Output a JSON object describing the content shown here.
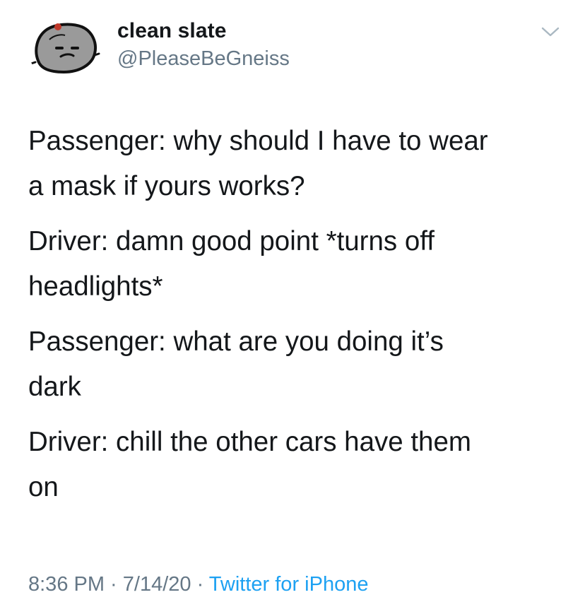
{
  "tweet": {
    "display_name": "clean slate",
    "handle": "@PleaseBeGneiss",
    "avatar_icon": "rock-character-avatar",
    "menu_icon": "chevron-down-icon",
    "lines": [
      "Passenger: why should I have to wear\na mask if yours works?",
      "Driver: damn good point *turns off\nheadlights*",
      "Passenger: what are you doing it’s\ndark",
      "Driver: chill the other cars have them\non"
    ],
    "time": "8:36 PM",
    "separator": " · ",
    "date": "7/14/20",
    "source": "Twitter for iPhone"
  },
  "colors": {
    "text": "#14171a",
    "muted": "#657786",
    "link": "#1da1f2",
    "background": "#ffffff"
  }
}
